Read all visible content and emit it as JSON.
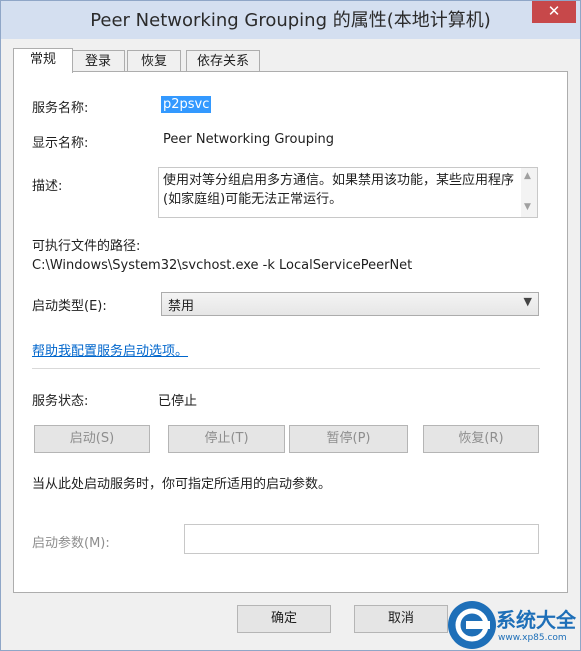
{
  "window": {
    "title": "Peer Networking Grouping 的属性(本地计算机)",
    "close_glyph": "✕"
  },
  "tabs": [
    "常规",
    "登录",
    "恢复",
    "依存关系"
  ],
  "general": {
    "service_name_label": "服务名称:",
    "service_name_value": "p2psvc",
    "display_name_label": "显示名称:",
    "display_name_value": "Peer Networking Grouping",
    "description_label": "描述:",
    "description_value": "使用对等分组启用多方通信。如果禁用该功能，某些应用程序(如家庭组)可能无法正常运行。",
    "exe_path_label": "可执行文件的路径:",
    "exe_path_value": "C:\\Windows\\System32\\svchost.exe -k LocalServicePeerNet",
    "startup_type_label": "启动类型(E):",
    "startup_type_value": "禁用",
    "help_link": "帮助我配置服务启动选项。",
    "status_label": "服务状态:",
    "status_value": "已停止",
    "buttons": {
      "start": "启动(S)",
      "stop": "停止(T)",
      "pause": "暂停(P)",
      "resume": "恢复(R)"
    },
    "hint": "当从此处启动服务时，你可指定所适用的启动参数。",
    "params_label": "启动参数(M):",
    "params_value": ""
  },
  "footer": {
    "ok": "确定",
    "cancel": "取消"
  },
  "watermark": {
    "text": "系统大全",
    "url": "www.xp85.com"
  },
  "icons": {
    "scroll_up": "▲",
    "scroll_down": "▼",
    "dropdown": "▼"
  },
  "colors": {
    "selection": "#3399ff",
    "link": "#0066cc",
    "close": "#c7484a",
    "watermark": "#1e6fb8"
  }
}
